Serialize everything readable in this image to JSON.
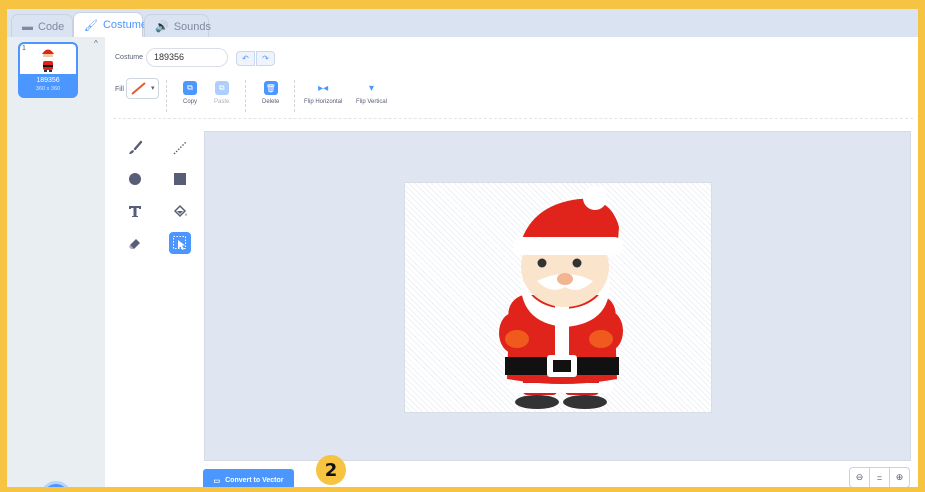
{
  "tabs": [
    {
      "label": "Code",
      "icon": "code-icon"
    },
    {
      "label": "Costumes",
      "icon": "brush-icon"
    },
    {
      "label": "Sounds",
      "icon": "speaker-icon"
    }
  ],
  "costume_list": {
    "items": [
      {
        "number": "1",
        "name": "189356",
        "size": "360 x 360"
      }
    ]
  },
  "editor": {
    "costume_label": "Costume",
    "costume_name": "189356",
    "fill_label": "Fill",
    "fill_color": "#e85a2c",
    "tools_row": {
      "copy": "Copy",
      "paste": "Paste",
      "delete": "Delete",
      "flip_horizontal": "Flip Horizontal",
      "flip_vertical": "Flip Vertical"
    },
    "convert_button": "Convert to Vector",
    "step_badge": "2",
    "zoom": {
      "out": "−",
      "reset": "=",
      "in": "+"
    }
  },
  "colors": {
    "accent": "#4c97ff",
    "highlight_border": "#f6c342"
  }
}
